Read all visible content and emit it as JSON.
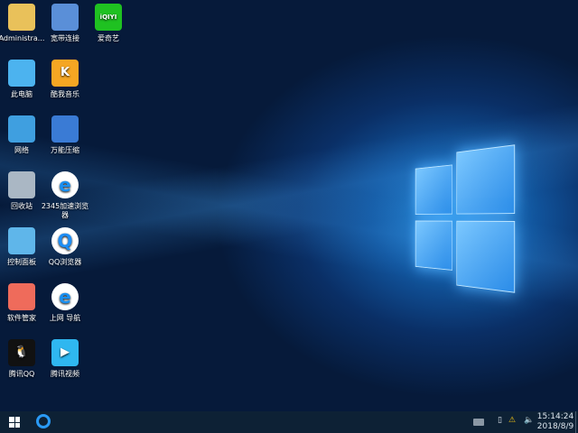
{
  "desktop": {
    "icons": [
      {
        "label": "Administra...",
        "icon": "user-folder-icon",
        "color": "#e9c15a"
      },
      {
        "label": "宽带连接",
        "icon": "network-connection-icon",
        "color": "#5a8fd8"
      },
      {
        "label": "爱奇艺",
        "icon": "iqiyi-icon",
        "color": "#1fc121",
        "glyph": "iQIYI"
      },
      {
        "label": "此电脑",
        "icon": "computer-icon",
        "color": "#4cb3ef"
      },
      {
        "label": "酷我音乐",
        "icon": "kuwo-music-icon",
        "color": "#f5a623",
        "glyph": "K"
      },
      {
        "label": "网络",
        "icon": "network-icon",
        "color": "#3f9fe0"
      },
      {
        "label": "万能压缩",
        "icon": "archive-icon",
        "color": "#3a7bd5"
      },
      {
        "label": "回收站",
        "icon": "recycle-bin-icon",
        "color": "#aab7c4"
      },
      {
        "label": "2345加速浏览器",
        "icon": "browser-2345-icon",
        "color": "#1a8ff0",
        "glyph": "e"
      },
      {
        "label": "控制面板",
        "icon": "control-panel-icon",
        "color": "#5fb6ea"
      },
      {
        "label": "QQ浏览器",
        "icon": "qq-browser-icon",
        "color": "#1e8ef5",
        "glyph": "Q"
      },
      {
        "label": "软件管家",
        "icon": "software-manager-icon",
        "color": "#ef6b5b"
      },
      {
        "label": "上网 导航",
        "icon": "ie-navigation-icon",
        "color": "#1a8ff0",
        "glyph": "e"
      },
      {
        "label": "腾讯QQ",
        "icon": "qq-penguin-icon",
        "color": "#111111",
        "glyph": "🐧"
      },
      {
        "label": "腾讯视频",
        "icon": "tencent-video-icon",
        "color": "#2fb7f0",
        "glyph": "▶"
      }
    ]
  },
  "taskbar": {
    "start": "windows-start-icon",
    "pinned": "qq-browser-icon",
    "time": "15:14:24",
    "date": "2018/8/9"
  }
}
